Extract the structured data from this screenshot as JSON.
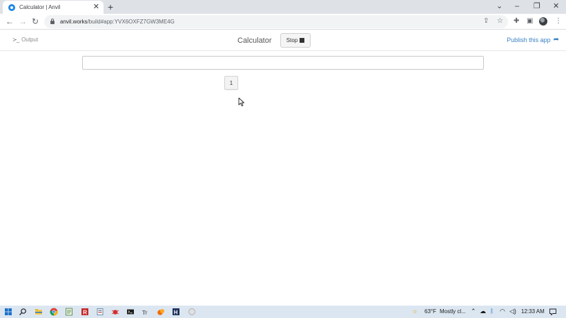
{
  "browser": {
    "tab_title": "Calculator | Anvil",
    "tab_close": "✕",
    "new_tab": "+",
    "url_host": "anvil.works",
    "url_path": "/build#app:YVX6OXFZ7GW3ME4G",
    "window_controls": {
      "dropdown": "⌄",
      "minimize": "–",
      "restore": "❐",
      "close": "✕"
    }
  },
  "app_header": {
    "output_prompt": "≻_",
    "output_label": "Output",
    "title": "Calculator",
    "stop_label": "Stop",
    "publish_label": "Publish this app"
  },
  "app": {
    "display_value": "",
    "key_label": "1"
  },
  "taskbar": {
    "temperature": "63°F",
    "weather": "Mostly cl...",
    "time": "12:33 AM"
  },
  "colors": {
    "accent_link": "#3b82c4",
    "taskbar": "#dbe6f1",
    "tabstrip": "#dee1e6"
  },
  "icons": [
    "anvil-favicon-icon",
    "back-arrow-icon",
    "forward-arrow-icon",
    "reload-icon",
    "lock-icon",
    "share-icon",
    "star-icon",
    "extensions-icon",
    "side-panel-icon",
    "profile-avatar",
    "menu-dots-icon",
    "share-arrow-icon",
    "mouse-cursor-icon",
    "windows-start-icon",
    "search-icon",
    "file-explorer-icon",
    "chrome-icon",
    "notepad-icon",
    "weather-icon",
    "chevron-up-icon",
    "onedrive-icon",
    "bluetooth-icon",
    "wifi-icon",
    "volume-icon",
    "notification-icon"
  ]
}
